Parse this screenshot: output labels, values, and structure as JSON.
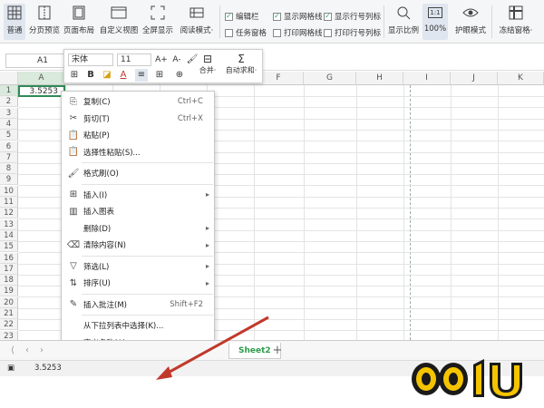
{
  "ribbon": {
    "buttons": [
      {
        "label": "普通",
        "icon": "grid-icon"
      },
      {
        "label": "分页预览",
        "icon": "page-preview-icon"
      },
      {
        "label": "页面布局",
        "icon": "page-layout-icon"
      },
      {
        "label": "自定义视图",
        "icon": "custom-view-icon"
      },
      {
        "label": "全屏显示",
        "icon": "fullscreen-icon"
      },
      {
        "label": "阅读模式·",
        "icon": "read-mode-icon"
      }
    ],
    "checks": [
      {
        "label": "编辑栏",
        "checked": true
      },
      {
        "label": "任务窗格",
        "checked": false
      },
      {
        "label": "显示网格线",
        "checked": true
      },
      {
        "label": "打印网格线",
        "checked": false
      },
      {
        "label": "显示行号列标",
        "checked": true
      },
      {
        "label": "打印行号列标",
        "checked": false
      }
    ],
    "right_buttons": [
      {
        "label": "显示比例",
        "icon": "zoom-icon"
      },
      {
        "label": "100%",
        "icon": "one-to-one-icon",
        "icon_text": "1:1"
      },
      {
        "label": "护眼模式",
        "icon": "eye-icon"
      },
      {
        "label": "冻结窗格·",
        "icon": "freeze-icon"
      }
    ]
  },
  "formula_bar": {
    "name_box": "A1"
  },
  "mini_toolbar": {
    "font": "宋体",
    "size": "11",
    "grow": "A+",
    "shrink": "A-",
    "merge": "合并·",
    "autosum": "自动求和·"
  },
  "columns": [
    "A",
    "B",
    "C",
    "D",
    "E",
    "F",
    "G",
    "H",
    "I",
    "J",
    "K"
  ],
  "rows": [
    "1",
    "2",
    "3",
    "4",
    "5",
    "6",
    "7",
    "8",
    "9",
    "10",
    "11",
    "12",
    "13",
    "14",
    "15",
    "16",
    "17",
    "18",
    "19",
    "20",
    "21",
    "22",
    "23"
  ],
  "cell_a1": "3.5253",
  "context_menu": [
    {
      "label": "复制(C)",
      "icon": "copy-icon",
      "glyph": "⎘",
      "shortcut": "Ctrl+C"
    },
    {
      "label": "剪切(T)",
      "icon": "cut-icon",
      "glyph": "✂",
      "shortcut": "Ctrl+X"
    },
    {
      "label": "粘贴(P)",
      "icon": "paste-icon",
      "glyph": "📋",
      "shortcut": ""
    },
    {
      "label": "选择性粘贴(S)...",
      "icon": "paste-special-icon",
      "glyph": "📋",
      "shortcut": ""
    },
    {
      "sep": true
    },
    {
      "label": "格式刷(O)",
      "icon": "format-painter-icon",
      "glyph": "🖌",
      "shortcut": ""
    },
    {
      "sep": true
    },
    {
      "label": "插入(I)",
      "icon": "insert-icon",
      "glyph": "⊞",
      "submenu": true
    },
    {
      "label": "插入图表",
      "icon": "chart-icon",
      "glyph": "▥"
    },
    {
      "label": "删除(D)",
      "icon": "",
      "glyph": "",
      "submenu": true
    },
    {
      "label": "清除内容(N)",
      "icon": "eraser-icon",
      "glyph": "⌫",
      "submenu": true
    },
    {
      "sep": true
    },
    {
      "label": "筛选(L)",
      "icon": "filter-icon",
      "glyph": "▽",
      "submenu": true
    },
    {
      "label": "排序(U)",
      "icon": "sort-icon",
      "glyph": "⇅",
      "submenu": true
    },
    {
      "sep": true
    },
    {
      "label": "插入批注(M)",
      "icon": "comment-icon",
      "glyph": "✎",
      "shortcut": "Shift+F2"
    },
    {
      "sep": true
    },
    {
      "label": "从下拉列表中选择(K)...",
      "icon": "",
      "glyph": ""
    },
    {
      "label": "定义名称(A)...",
      "icon": "",
      "glyph": ""
    },
    {
      "label": "超链接(H)...",
      "icon": "link-icon",
      "glyph": "⛓",
      "shortcut": "Ctrl+K"
    },
    {
      "label": "设置单元格格式(F)...",
      "icon": "format-cells-icon",
      "glyph": "⚙",
      "shortcut": "Ctrl+1"
    },
    {
      "sep": true
    },
    {
      "label": "快捷筛选(B)",
      "icon": "quick-filter-icon",
      "glyph": "▽",
      "badge": "👑"
    }
  ],
  "sheet_tab": "Sheet2",
  "status_value": "3.5253",
  "watermark": "OO1U",
  "colors": {
    "accent": "#2e8b57",
    "arrow": "#c0392b",
    "sheet_tab": "#2e9b4a"
  }
}
